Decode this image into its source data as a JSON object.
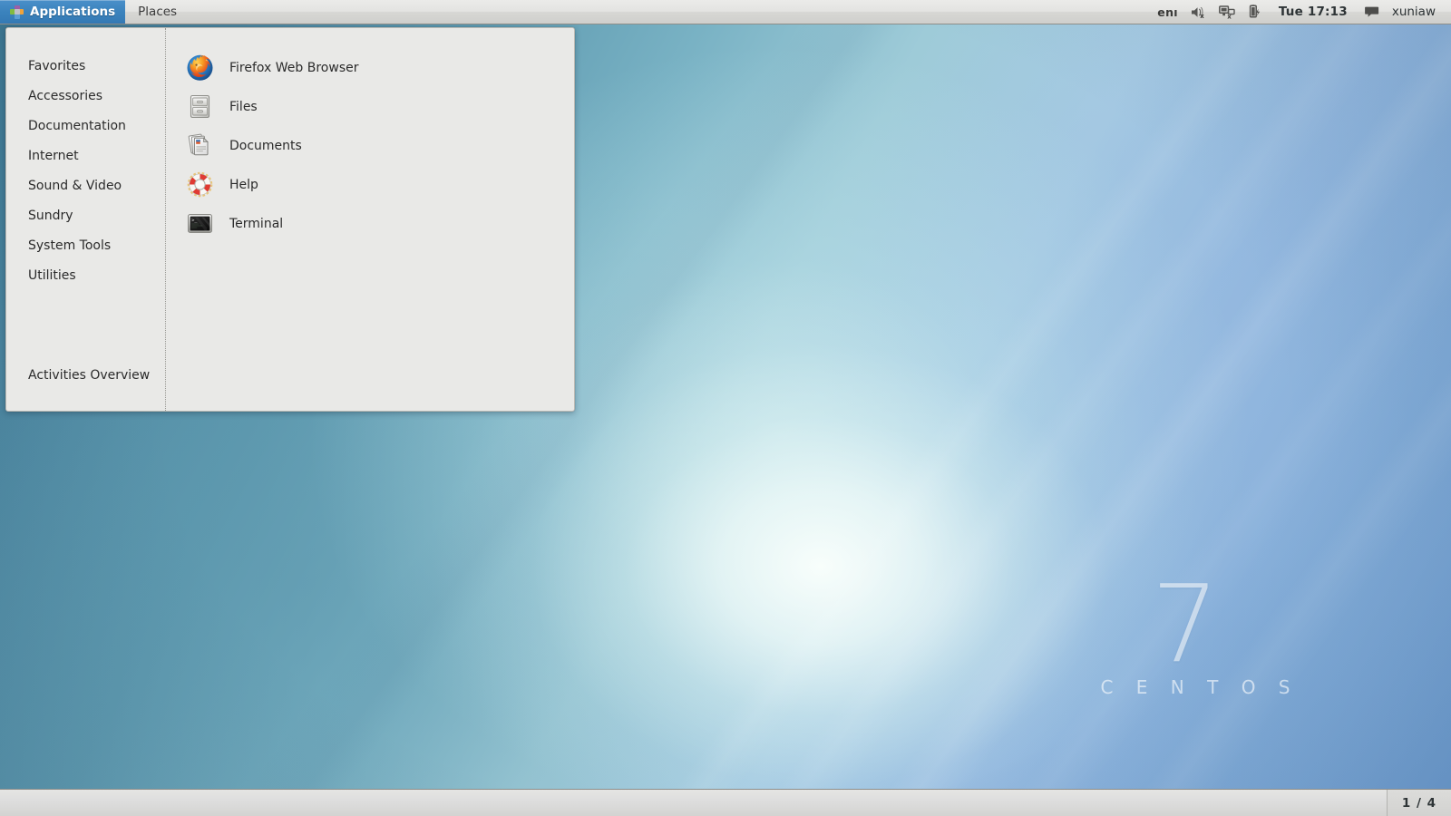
{
  "topbar": {
    "logo_icon": "centos-pinwheel-icon",
    "applications_label": "Applications",
    "places_label": "Places",
    "keyboard_layout": "enı",
    "volume_icon": "volume-muted-icon",
    "network_icon": "network-disconnected-icon",
    "battery_icon": "battery-charging-icon",
    "clock": "Tue 17:13",
    "message_icon": "message-tray-icon",
    "username": "xuniaw"
  },
  "app_menu": {
    "categories": [
      {
        "label": "Favorites"
      },
      {
        "label": "Accessories"
      },
      {
        "label": "Documentation"
      },
      {
        "label": "Internet"
      },
      {
        "label": "Sound & Video"
      },
      {
        "label": "Sundry"
      },
      {
        "label": "System Tools"
      },
      {
        "label": "Utilities"
      }
    ],
    "overview_label": "Activities Overview",
    "applications": [
      {
        "label": "Firefox Web Browser",
        "icon": "firefox-icon"
      },
      {
        "label": "Files",
        "icon": "file-cabinet-icon"
      },
      {
        "label": "Documents",
        "icon": "documents-icon"
      },
      {
        "label": "Help",
        "icon": "lifebuoy-help-icon"
      },
      {
        "label": "Terminal",
        "icon": "terminal-icon"
      }
    ]
  },
  "desktop": {
    "brand_version": "7",
    "brand_name": "C E N T O S"
  },
  "bottombar": {
    "workspace_indicator": "1 / 4"
  },
  "colors": {
    "accent_blue": "#3b83bd",
    "panel_bg": "#e9e9e7",
    "text": "#2b2b2b",
    "wallpaper_deep": "#3f7b95"
  }
}
